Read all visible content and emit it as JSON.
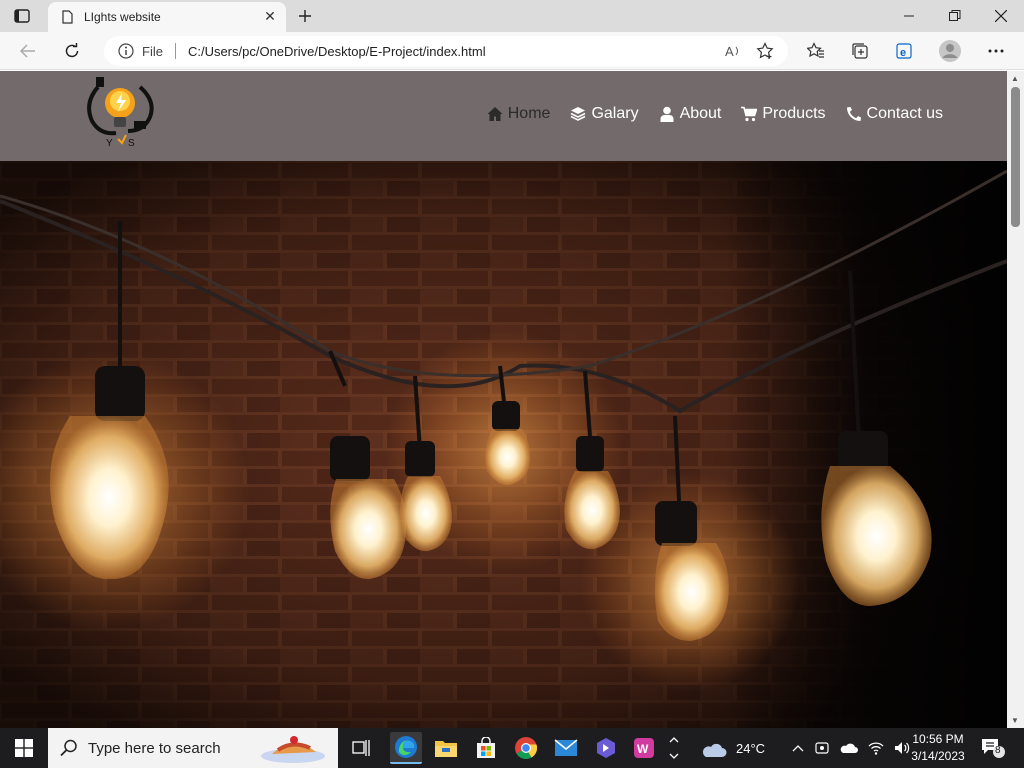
{
  "browser": {
    "tab_title": "LIghts website",
    "address_scheme": "File",
    "address_url": "C:/Users/pc/OneDrive/Desktop/E-Project/index.html"
  },
  "site": {
    "logo_text": "YS",
    "nav": [
      {
        "label": "Home",
        "icon": "home-icon"
      },
      {
        "label": "Galary",
        "icon": "layers-icon"
      },
      {
        "label": "About",
        "icon": "user-icon"
      },
      {
        "label": "Products",
        "icon": "cart-icon"
      },
      {
        "label": "Contact us",
        "icon": "phone-icon"
      }
    ]
  },
  "taskbar": {
    "search_placeholder": "Type here to search",
    "weather_temp": "24°C",
    "time": "10:56 PM",
    "date": "3/14/2023",
    "notification_count": "8"
  }
}
